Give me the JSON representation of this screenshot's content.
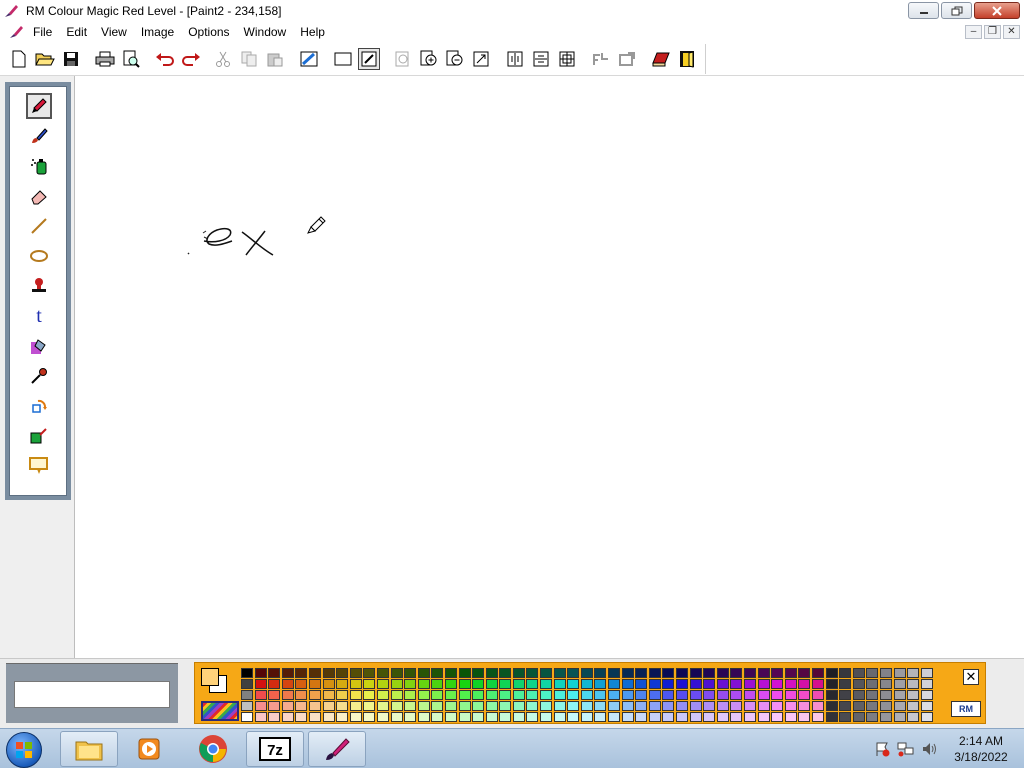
{
  "window": {
    "title": "RM Colour Magic  Red Level  - [Paint2 - 234,158]"
  },
  "menubar": {
    "items": [
      "File",
      "Edit",
      "View",
      "Image",
      "Options",
      "Window",
      "Help"
    ]
  },
  "toolbar": {
    "buttons": [
      "new-file",
      "open-folder",
      "save",
      "print",
      "print-preview",
      "undo",
      "redo",
      "cut",
      "copy",
      "paste",
      "image-settings",
      "frame",
      "draw-mode",
      "page-select",
      "zoom-in",
      "zoom-out",
      "fit",
      "mirror-vertical",
      "mirror-horizontal",
      "grid",
      "effects-a",
      "effects-b",
      "book",
      "exit-door"
    ]
  },
  "tools": [
    "pencil",
    "brush",
    "spray-can",
    "eraser",
    "line",
    "ellipse",
    "stamp",
    "text",
    "fill",
    "eyedropper",
    "rotate",
    "shape-fill",
    "select-area"
  ],
  "active_tool": "pencil",
  "palette": {
    "foreground": "#ffd27a",
    "background": "#ffffff",
    "columns": 51,
    "rows": 5
  },
  "taskbar": {
    "apps": [
      "windows-explorer",
      "media-player",
      "chrome",
      "7zip",
      "colour-magic"
    ],
    "time": "2:14 AM",
    "date": "3/18/2022"
  },
  "colors": {
    "palette_bg": "#f6a816",
    "toolbox_bg": "#7a8da0",
    "taskbar_top": "#c5d7ea"
  }
}
